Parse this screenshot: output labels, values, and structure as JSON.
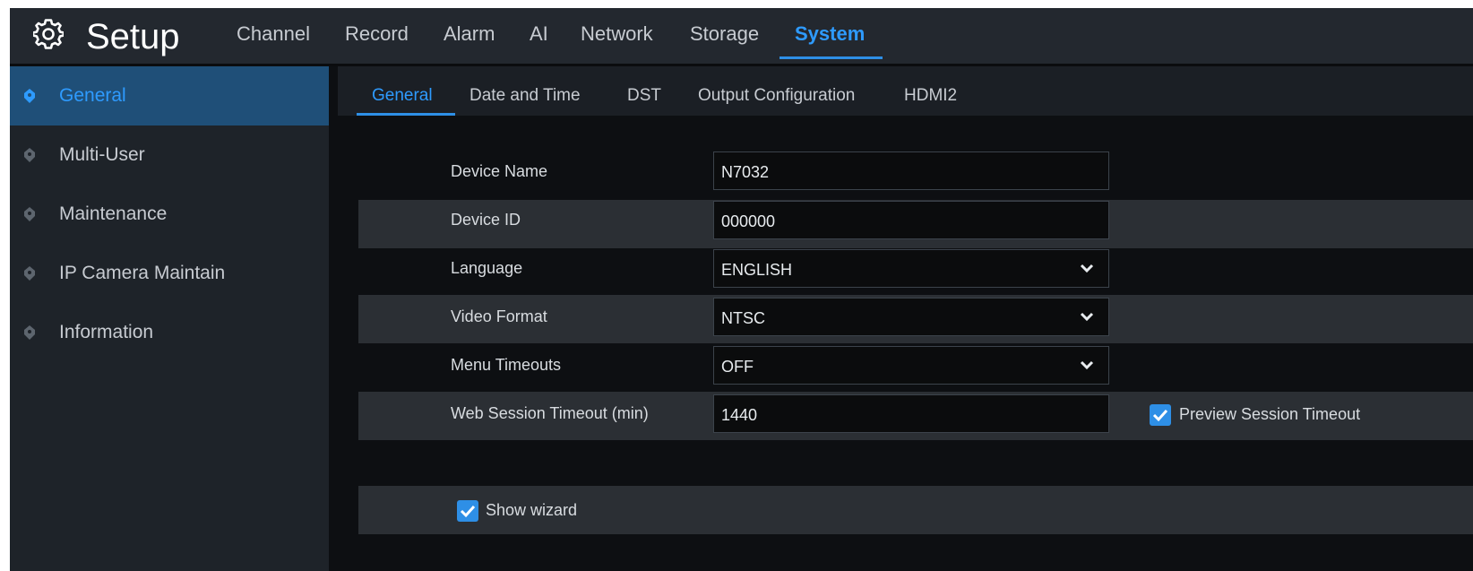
{
  "header": {
    "title": "Setup",
    "icon": "gear-icon",
    "tabs": [
      "Channel",
      "Record",
      "Alarm",
      "AI",
      "Network",
      "Storage",
      "System"
    ],
    "active_tab": "System"
  },
  "sidebar": {
    "items": [
      {
        "label": "General",
        "active": true
      },
      {
        "label": "Multi-User",
        "active": false
      },
      {
        "label": "Maintenance",
        "active": false
      },
      {
        "label": "IP Camera Maintain",
        "active": false
      },
      {
        "label": "Information",
        "active": false
      }
    ]
  },
  "subtabs": [
    "General",
    "Date and Time",
    "DST",
    "Output Configuration",
    "HDMI2"
  ],
  "form": {
    "device_name": {
      "label": "Device Name",
      "value": "N7032"
    },
    "device_id": {
      "label": "Device ID",
      "value": "000000"
    },
    "language": {
      "label": "Language",
      "value": "ENGLISH"
    },
    "video_format": {
      "label": "Video Format",
      "value": "NTSC"
    },
    "menu_timeouts": {
      "label": "Menu Timeouts",
      "value": "OFF"
    },
    "web_session_timeout": {
      "label": "Web Session Timeout (min)",
      "value": "1440"
    },
    "preview_session_timeout": {
      "label": "Preview Session Timeout",
      "checked": true
    },
    "show_wizard": {
      "label": "Show wizard",
      "checked": true
    }
  },
  "colors": {
    "accent": "#2e9bff",
    "active_sidebar_bg": "#1f4f78",
    "topbar_bg": "#23282f",
    "row_band_bg": "#2b2f34"
  }
}
